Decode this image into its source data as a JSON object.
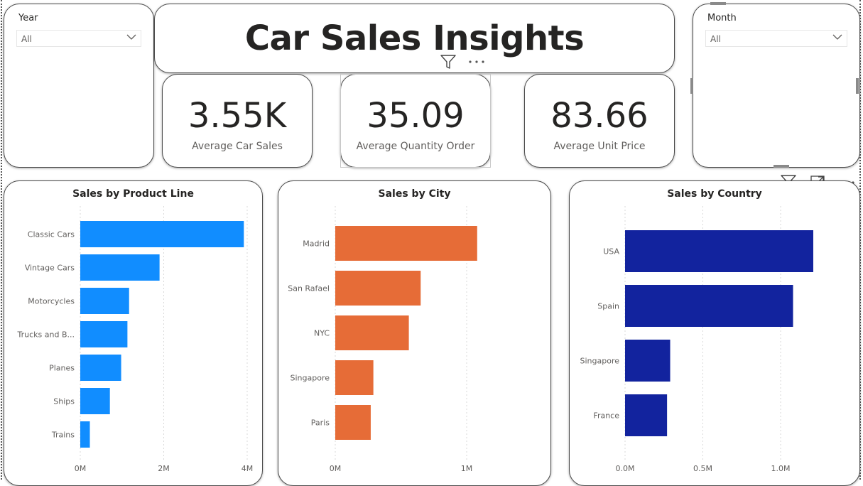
{
  "report": {
    "title": "Car Sales  Insights"
  },
  "slicers": {
    "year": {
      "label": "Year",
      "value": "All"
    },
    "month": {
      "label": "Month",
      "value": "All"
    }
  },
  "kpis": [
    {
      "value": "3.55K",
      "label": "Average Car Sales"
    },
    {
      "value": "35.09",
      "label": "Average Quantity Order"
    },
    {
      "value": "83.66",
      "label": "Average Unit Price"
    }
  ],
  "icons": {
    "filter": "filter-icon",
    "more": "more-options-icon",
    "focus": "focus-mode-icon",
    "dropdown": "chevron-down-icon"
  },
  "colors": {
    "product_line": "#118DFF",
    "city": "#E66C37",
    "country": "#12239E"
  },
  "chart_data": [
    {
      "type": "bar",
      "orientation": "horizontal",
      "title": "Sales by Product Line",
      "categories": [
        "Classic Cars",
        "Vintage Cars",
        "Motorcycles",
        "Trucks and B...",
        "Planes",
        "Ships",
        "Trains"
      ],
      "values": [
        3920000,
        1900000,
        1170000,
        1130000,
        980000,
        710000,
        230000
      ],
      "xlim": [
        0,
        4000000
      ],
      "ticks": [
        0,
        2000000,
        4000000
      ],
      "tick_labels": [
        "0M",
        "2M",
        "4M"
      ],
      "grid": true
    },
    {
      "type": "bar",
      "orientation": "horizontal",
      "title": "Sales by City",
      "categories": [
        "Madrid",
        "San Rafael",
        "NYC",
        "Singapore",
        "Paris"
      ],
      "values": [
        1080000,
        650000,
        560000,
        290000,
        270000
      ],
      "xlim": [
        0,
        1000000
      ],
      "ticks": [
        0,
        1000000
      ],
      "tick_labels": [
        "0M",
        "1M"
      ],
      "grid": true
    },
    {
      "type": "bar",
      "orientation": "horizontal",
      "title": "Sales by Country",
      "categories": [
        "USA",
        "Spain",
        "Singapore",
        "France"
      ],
      "values": [
        1210000,
        1080000,
        290000,
        270000
      ],
      "xlim": [
        0,
        1000000
      ],
      "ticks": [
        0,
        500000,
        1000000
      ],
      "tick_labels": [
        "0.0M",
        "0.5M",
        "1.0M"
      ],
      "grid": true
    }
  ]
}
